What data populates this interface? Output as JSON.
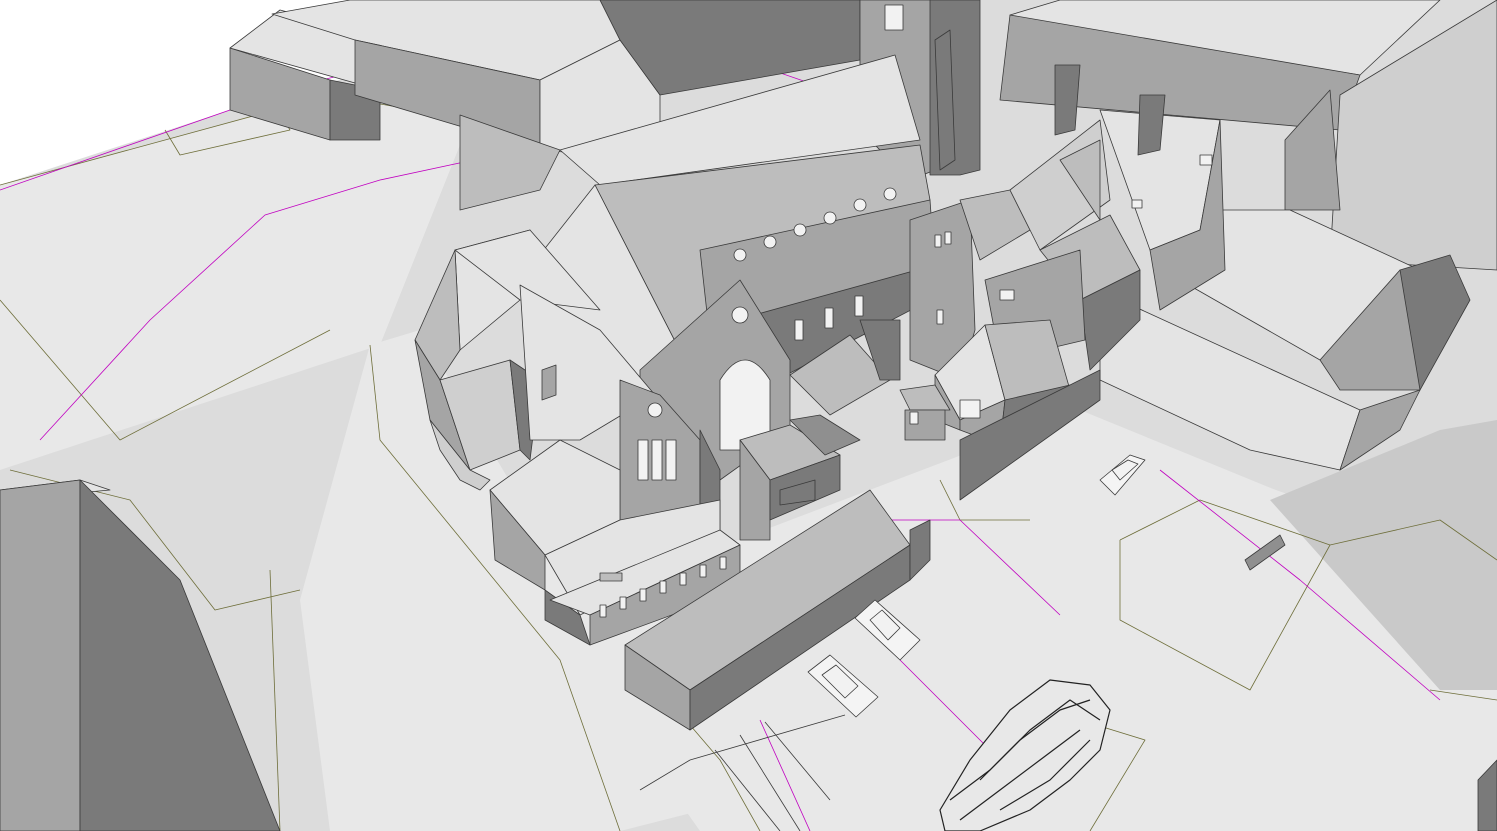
{
  "viewport": {
    "view": "3d-perspective",
    "style": "hidden-line",
    "background_color": "#ffffff"
  },
  "palette": {
    "ground": "#dcdcdc",
    "ground_light": "#e8e8e8",
    "ground_shadow": "#c9c9c9",
    "roof_light": "#e4e4e4",
    "roof_mid": "#bdbdbd",
    "roof_dark": "#8f8f8f",
    "wall_light": "#cfcfcf",
    "wall_mid": "#a5a5a5",
    "wall_dark": "#7a7a7a",
    "edge": "#3a3a3a",
    "site_line": "#6e6e3a",
    "boundary_line": "#c000c0",
    "window": "#f2f2f2",
    "vehicle": "#f4f4f4",
    "tree": "#222222"
  },
  "scene_objects": {
    "buildings": [
      "church",
      "tower",
      "octagonal-apse",
      "parish-hall",
      "north-block",
      "east-block",
      "west-block",
      "south-annex",
      "long-shed"
    ],
    "vehicles_count": 3,
    "trees_count": 1,
    "parking_bays": 4
  }
}
